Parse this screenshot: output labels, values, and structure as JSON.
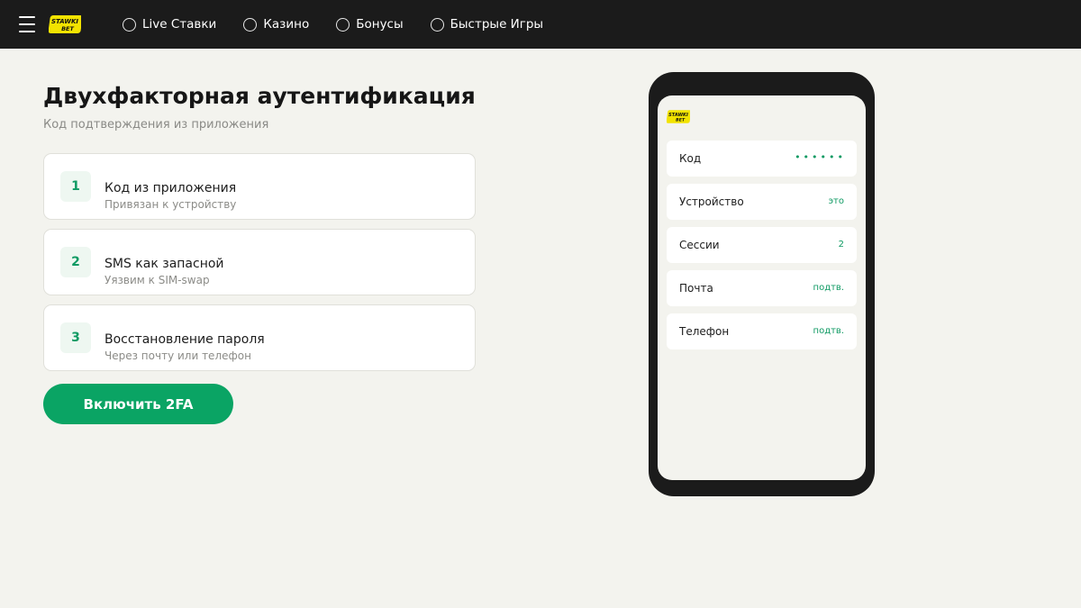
{
  "brand": {
    "logo_text_top": "STAWKI",
    "logo_text_bottom": "BET",
    "accent": "#f2e300",
    "primary_green": "#0aa464",
    "topbar_bg": "#1b1b1b"
  },
  "topbar": {
    "menu_icon": "hamburger-icon",
    "nav": [
      {
        "label": "Live Ставки",
        "icon": "circle-icon"
      },
      {
        "label": "Казино",
        "icon": "circle-icon"
      },
      {
        "label": "Бонусы",
        "icon": "circle-icon"
      },
      {
        "label": "Быстрые Игры",
        "icon": "circle-icon"
      }
    ]
  },
  "main": {
    "title": "Двухфакторная аутентификация",
    "subtitle": "Код подтверждения из приложения",
    "steps": [
      {
        "num": "1",
        "title": "Код из приложения",
        "sub": "Привязан к устройству"
      },
      {
        "num": "2",
        "title": "SMS как запасной",
        "sub": "Уязвим к SIM-swap"
      },
      {
        "num": "3",
        "title": "Восстановление пароля",
        "sub": "Через почту или телефон"
      }
    ],
    "enable_label": "Включить 2FA"
  },
  "phone": {
    "rows": [
      {
        "label": "Код",
        "value": "••••••"
      },
      {
        "label": "Устройство",
        "value": "это"
      },
      {
        "label": "Сессии",
        "value": "2"
      },
      {
        "label": "Почта",
        "value": "подтв."
      },
      {
        "label": "Телефон",
        "value": "подтв."
      }
    ]
  }
}
